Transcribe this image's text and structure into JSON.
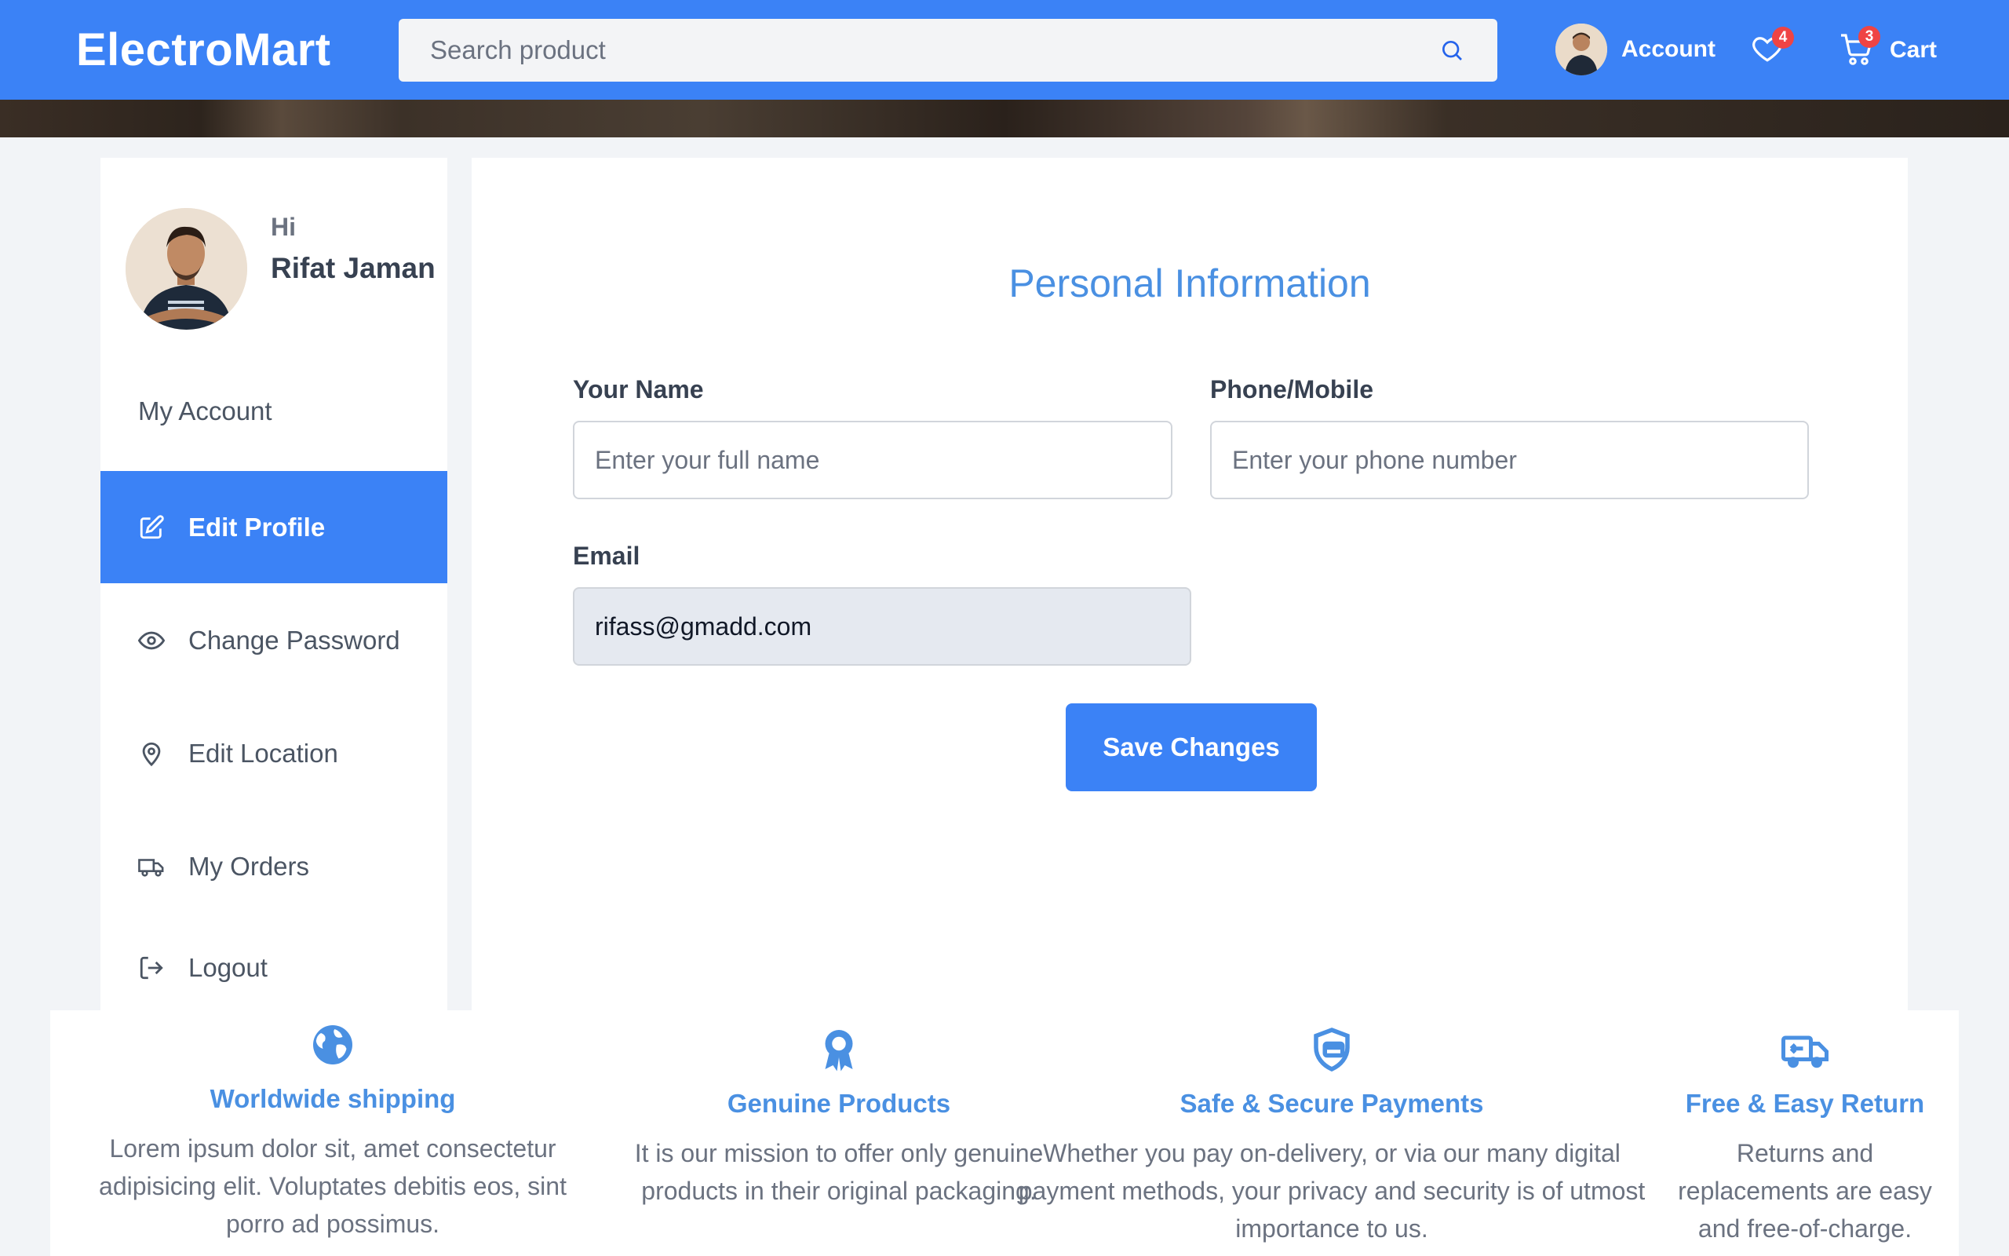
{
  "header": {
    "logo": "ElectroMart",
    "search_placeholder": "Search product",
    "account_label": "Account",
    "wishlist_count": "4",
    "cart_count": "3",
    "cart_label": "Cart"
  },
  "sidebar": {
    "greeting": "Hi",
    "user_name": "Rifat Jaman",
    "section_title": "My Account",
    "items": [
      {
        "label": "Edit Profile",
        "icon": "edit-icon",
        "active": true
      },
      {
        "label": "Change Password",
        "icon": "eye-icon"
      },
      {
        "label": "Edit Location",
        "icon": "location-pin-icon"
      },
      {
        "label": "My Orders",
        "icon": "truck-icon"
      },
      {
        "label": "Logout",
        "icon": "logout-icon"
      }
    ]
  },
  "form": {
    "title": "Personal Information",
    "name_label": "Your Name",
    "name_placeholder": "Enter your full name",
    "phone_label": "Phone/Mobile",
    "phone_placeholder": "Enter your phone number",
    "email_label": "Email",
    "email_value": "rifass@gmadd.com",
    "save_label": "Save Changes"
  },
  "features": [
    {
      "title": "Worldwide shipping",
      "text": "Lorem ipsum dolor sit, amet consectetur adipisicing elit. Voluptates debitis eos, sint porro ad possimus.",
      "icon": "globe-icon"
    },
    {
      "title": "Genuine Products",
      "text": "It is our mission to offer only genuine products in their original packaging.",
      "icon": "award-ribbon-icon"
    },
    {
      "title": "Safe & Secure Payments",
      "text": "Whether you pay on-delivery, or via our many digital payment methods, your privacy and security is of utmost importance to us.",
      "icon": "shield-card-icon"
    },
    {
      "title": "Free & Easy Return",
      "text": "Returns and replacements are easy and free-of-charge.",
      "icon": "return-truck-icon"
    }
  ],
  "colors": {
    "primary": "#3b82f6",
    "title_blue": "#4a90e2",
    "badge": "#ef4444"
  }
}
